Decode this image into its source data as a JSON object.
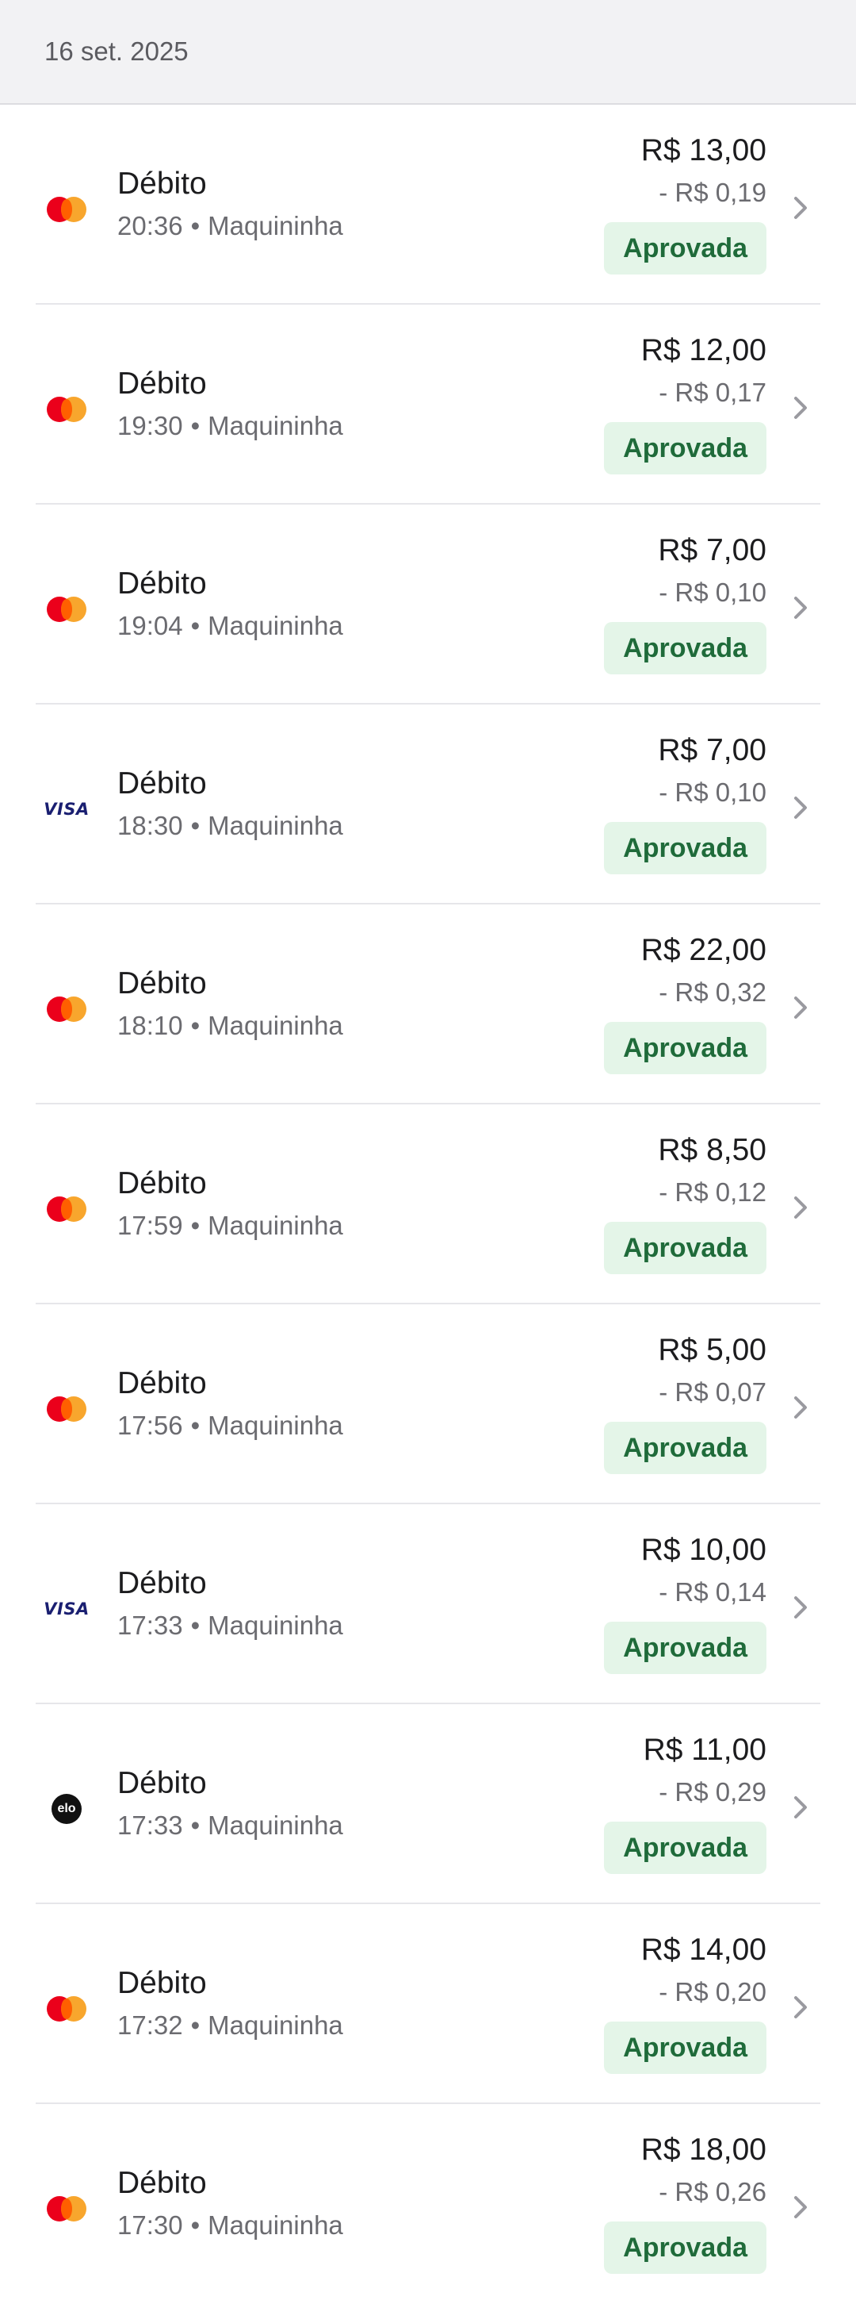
{
  "date_header": "16 set. 2025",
  "transactions": [
    {
      "brand": "mastercard",
      "type": "Débito",
      "time": "20:36",
      "channel": "Maquininha",
      "amount": "R$ 13,00",
      "fee": "- R$ 0,19",
      "status": "Aprovada"
    },
    {
      "brand": "mastercard",
      "type": "Débito",
      "time": "19:30",
      "channel": "Maquininha",
      "amount": "R$ 12,00",
      "fee": "- R$ 0,17",
      "status": "Aprovada"
    },
    {
      "brand": "mastercard",
      "type": "Débito",
      "time": "19:04",
      "channel": "Maquininha",
      "amount": "R$ 7,00",
      "fee": "- R$ 0,10",
      "status": "Aprovada"
    },
    {
      "brand": "visa",
      "type": "Débito",
      "time": "18:30",
      "channel": "Maquininha",
      "amount": "R$ 7,00",
      "fee": "- R$ 0,10",
      "status": "Aprovada"
    },
    {
      "brand": "mastercard",
      "type": "Débito",
      "time": "18:10",
      "channel": "Maquininha",
      "amount": "R$ 22,00",
      "fee": "- R$ 0,32",
      "status": "Aprovada"
    },
    {
      "brand": "mastercard",
      "type": "Débito",
      "time": "17:59",
      "channel": "Maquininha",
      "amount": "R$ 8,50",
      "fee": "- R$ 0,12",
      "status": "Aprovada"
    },
    {
      "brand": "mastercard",
      "type": "Débito",
      "time": "17:56",
      "channel": "Maquininha",
      "amount": "R$ 5,00",
      "fee": "- R$ 0,07",
      "status": "Aprovada"
    },
    {
      "brand": "visa",
      "type": "Débito",
      "time": "17:33",
      "channel": "Maquininha",
      "amount": "R$ 10,00",
      "fee": "- R$ 0,14",
      "status": "Aprovada"
    },
    {
      "brand": "elo",
      "type": "Débito",
      "time": "17:33",
      "channel": "Maquininha",
      "amount": "R$ 11,00",
      "fee": "- R$ 0,29",
      "status": "Aprovada"
    },
    {
      "brand": "mastercard",
      "type": "Débito",
      "time": "17:32",
      "channel": "Maquininha",
      "amount": "R$ 14,00",
      "fee": "- R$ 0,20",
      "status": "Aprovada"
    },
    {
      "brand": "mastercard",
      "type": "Débito",
      "time": "17:30",
      "channel": "Maquininha",
      "amount": "R$ 18,00",
      "fee": "- R$ 0,26",
      "status": "Aprovada"
    }
  ],
  "separator": "•",
  "brand_labels": {
    "visa": "VISA",
    "elo": "elo"
  },
  "colors": {
    "status_bg": "#e4f5e8",
    "status_text": "#1f6b3a",
    "mastercard_red": "#eb001b",
    "mastercard_orange": "#f79e1b",
    "visa_blue": "#1a1f71"
  },
  "icons": {
    "row_action": "chevron-right-icon"
  }
}
